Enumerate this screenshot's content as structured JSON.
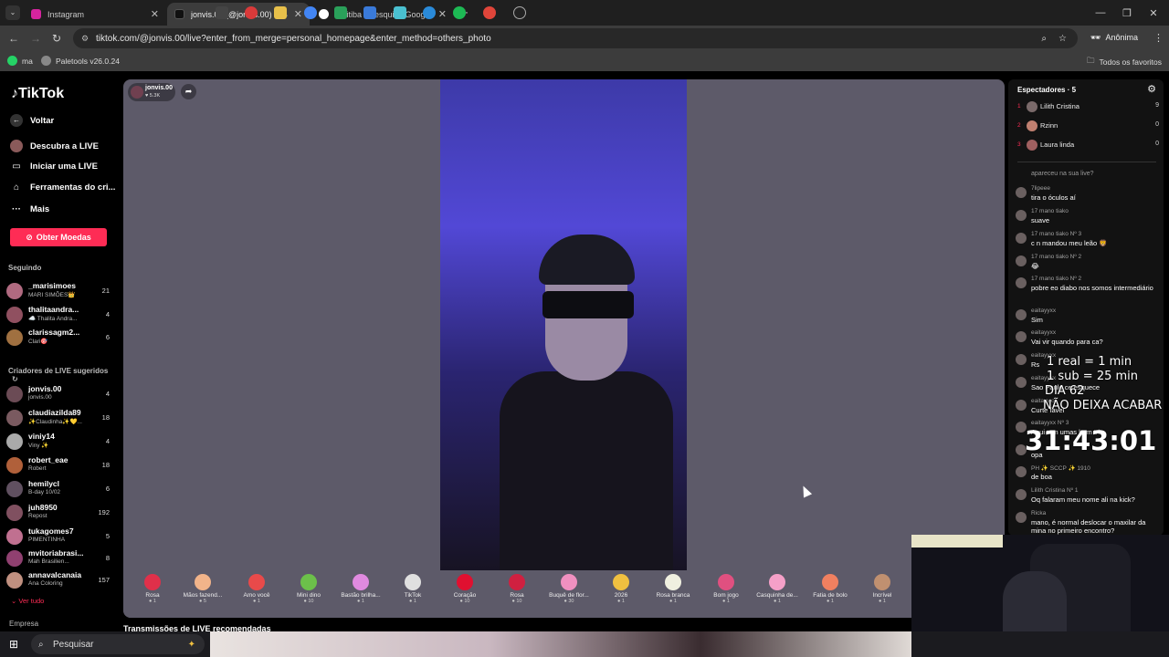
{
  "browser": {
    "tabs": [
      {
        "title": "Instagram",
        "color": "#d6249f"
      },
      {
        "title": "jonvis.00 (@jonvis.00) com",
        "color": "#111111"
      },
      {
        "title": "coritiba - Pesquisa Google",
        "color": "#4285f4"
      }
    ],
    "url": "tiktok.com/@jonvis.00/live?enter_from_merge=personal_homepage&enter_method=others_photo",
    "profile": "Anônima",
    "bookmarks": [
      "ma",
      "Paletools v26.0.24"
    ],
    "all_bookmarks": "Todos os favoritos"
  },
  "sidebar": {
    "logo": "TikTok",
    "menu": [
      {
        "icon": "back-arrow-icon",
        "label": "Voltar"
      },
      {
        "icon": "live-avatar-icon",
        "label": "Descubra a LIVE"
      },
      {
        "icon": "camera-icon",
        "label": "Iniciar uma LIVE"
      },
      {
        "icon": "home-icon",
        "label": "Ferramentas do cri..."
      },
      {
        "icon": "more-icon",
        "label": "Mais"
      }
    ],
    "coins_button": "Obter Moedas",
    "following_title": "Seguindo",
    "following": [
      {
        "name": "_marisimoes",
        "sub": "MARI SIMÕES👑",
        "count": "21"
      },
      {
        "name": "thalitaandra...",
        "sub": "☁️ Thalita Andra...",
        "count": "4"
      },
      {
        "name": "clarissagm2...",
        "sub": "Clari🎯",
        "count": "6"
      }
    ],
    "suggested_title": "Criadores de LIVE sugeridos",
    "suggested": [
      {
        "name": "jonvis.00",
        "sub": "jonvis.00",
        "count": "4"
      },
      {
        "name": "claudiazilda89",
        "sub": "✨Claudinha✨💛...",
        "count": "18"
      },
      {
        "name": "viniy14",
        "sub": "Viny ✨",
        "count": "4"
      },
      {
        "name": "robert_eae",
        "sub": "Robert",
        "count": "18"
      },
      {
        "name": "hemilycl",
        "sub": "B-day 10/02",
        "count": "6"
      },
      {
        "name": "juh8950",
        "sub": "Repost",
        "count": "192"
      },
      {
        "name": "tukagomes7",
        "sub": "PIMENTINHA",
        "count": "5"
      },
      {
        "name": "mvitoriabrasi...",
        "sub": "Mah Brasilien...",
        "count": "8"
      },
      {
        "name": "annavalcanaia",
        "sub": "Ana Coloring",
        "count": "157"
      }
    ],
    "see_all": "Ver tudo",
    "company": "Empresa"
  },
  "player": {
    "host_name": "jonvis.00",
    "host_likes": "5.3K"
  },
  "gifts": [
    {
      "label": "Rosa",
      "price": "1",
      "color": "#e0304a"
    },
    {
      "label": "Mãos fazend...",
      "price": "5",
      "color": "#f2b48a"
    },
    {
      "label": "Amo você",
      "price": "1",
      "color": "#e84a4a"
    },
    {
      "label": "Mini dino",
      "price": "10",
      "color": "#6cc04a"
    },
    {
      "label": "Bastão brilha...",
      "price": "1",
      "color": "#e08ae0"
    },
    {
      "label": "TikTok",
      "price": "1",
      "color": "#e0e0e0"
    },
    {
      "label": "Coração",
      "price": "10",
      "color": "#e01030"
    },
    {
      "label": "Rosa",
      "price": "10",
      "color": "#d02040"
    },
    {
      "label": "Buquê de flor...",
      "price": "30",
      "color": "#f090c0"
    },
    {
      "label": "2026",
      "price": "1",
      "color": "#f0c040"
    },
    {
      "label": "Rosa branca",
      "price": "1",
      "color": "#f0f0e0"
    },
    {
      "label": "Bom jogo",
      "price": "1",
      "color": "#e05080"
    },
    {
      "label": "Casquinha de...",
      "price": "1",
      "color": "#f5a0c8"
    },
    {
      "label": "Fatia de bolo",
      "price": "1",
      "color": "#f08060"
    },
    {
      "label": "Incrível",
      "price": "1",
      "color": "#c09070"
    }
  ],
  "chat": {
    "viewers_title": "Espectadores · 5",
    "viewers": [
      {
        "rank": "1",
        "name": "Lilith Cristina",
        "score": "9"
      },
      {
        "rank": "2",
        "name": "Rzinn",
        "score": "0"
      },
      {
        "rank": "3",
        "name": "Laura linda",
        "score": "0"
      }
    ],
    "partial_top": "apareceu na sua live?",
    "messages": [
      {
        "user": "7lipeee",
        "text": "tira o óculos aí"
      },
      {
        "user": "17 mano tiako",
        "text": "suave"
      },
      {
        "user": "17 mano tiako  Nº 3",
        "text": "c n mandou meu leão 🦁"
      },
      {
        "user": "17 mano tiako  Nº 2",
        "text": "😂"
      },
      {
        "user": "17 mano tiako  Nº 2",
        "text": "pobre eo diabo nos somos intermediário"
      },
      {
        "user": "eaitayyxx",
        "text": "Sim"
      },
      {
        "user": "eaitayyxx",
        "text": "Vai vir quando para ca?"
      },
      {
        "user": "eaitayyxx",
        "text": "Rs"
      },
      {
        "user": "eaitayyxx",
        "text": "Sao Paulo ce esquece"
      },
      {
        "user": "eaitayyxx",
        "text": "Curte favel"
      },
      {
        "user": "eaitayyxx  Nº 3",
        "text": "Aqui tem umas bem tri"
      },
      {
        "user": "",
        "text": "opa"
      },
      {
        "user": "PH ✨ SCCP ✨ 1910",
        "text": "de boa"
      },
      {
        "user": "Lilith Cristina  Nº 1",
        "text": "Oq falaram meu nome ali na kick?"
      },
      {
        "user": "Ricka",
        "text": "mano, é normal deslocar o maxilar da mina no primeiro encontro?"
      }
    ]
  },
  "overlay": {
    "line1": "1 real = 1 min",
    "line2": "1 sub = 25 min",
    "line3": "DIA 62",
    "line4": "NÃO DEIXA ACABAR",
    "timer": "31:43:01"
  },
  "recommended": "Transmissões de LIVE recomendadas",
  "taskbar": {
    "search": "Pesquisar"
  }
}
